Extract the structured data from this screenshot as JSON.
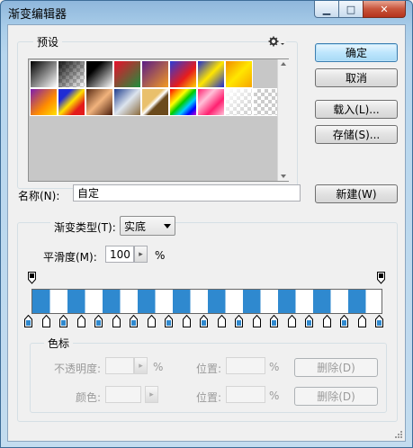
{
  "window": {
    "title": "渐变编辑器"
  },
  "titlebar_buttons": {
    "minimize": "▁",
    "maximize": "□",
    "close": "✕"
  },
  "presets": {
    "label": "预设",
    "menu_icon": "gear-icon"
  },
  "buttons": {
    "ok": "确定",
    "cancel": "取消",
    "load": "载入(L)...",
    "save": "存储(S)...",
    "new": "新建(W)"
  },
  "name": {
    "label": "名称(N):",
    "value": "自定"
  },
  "gradient_type": {
    "label": "渐变类型(T):",
    "value": "实底"
  },
  "smoothness": {
    "label": "平滑度(M):",
    "value": "100",
    "unit": "%"
  },
  "color_stops": {
    "group_label": "色标",
    "opacity_label": "不透明度:",
    "opacity_unit": "%",
    "opacity_location_label": "位置:",
    "opacity_location_unit": "%",
    "opacity_delete": "删除(D)",
    "color_label": "颜色:",
    "color_location_label": "位置:",
    "color_location_unit": "%",
    "color_delete": "删除(D)"
  },
  "colors": {
    "stripe": "#2f89cf",
    "stripe_alt": "#ffffff"
  }
}
